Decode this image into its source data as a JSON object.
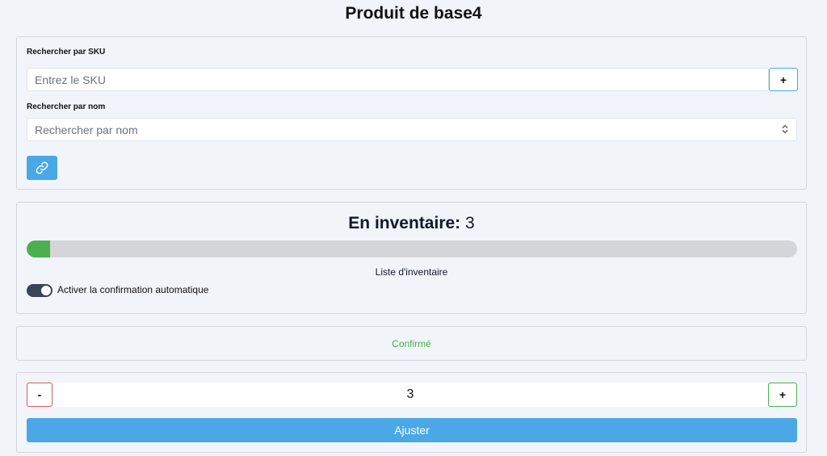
{
  "page": {
    "title": "Produit de base4"
  },
  "search": {
    "sku_label": "Rechercher par SKU",
    "sku_placeholder": "Entrez le SKU",
    "sku_add_label": "+",
    "name_label": "Rechercher par nom",
    "name_placeholder": "Rechercher par nom"
  },
  "inventory": {
    "title_label": "En inventaire:",
    "count": "3",
    "progress_fraction": 0.03,
    "list_label": "Liste d'inventaire",
    "auto_confirm_label": "Activer la confirmation automatique",
    "auto_confirm_on": true
  },
  "status": {
    "text": "Confirmé",
    "color": "#4caf50"
  },
  "adjust": {
    "minus_label": "-",
    "plus_label": "+",
    "quantity": "3",
    "submit_label": "Ajuster"
  },
  "colors": {
    "accent": "#4aa8e6",
    "danger": "#e05a5a",
    "success": "#4caf50"
  },
  "icons": {
    "link_button": "link-icon"
  }
}
